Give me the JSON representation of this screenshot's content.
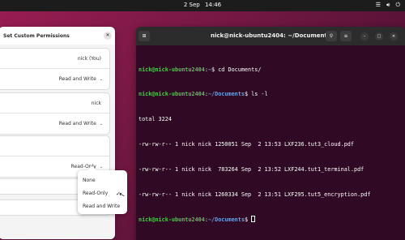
{
  "topbar": {
    "date": "2 Sep",
    "time": "14:46"
  },
  "dialog": {
    "title": "Set Custom Permissions",
    "owner": {
      "name": "nick (You)",
      "access": "Read and Write"
    },
    "group": {
      "name": "nick",
      "access": "Read and Write"
    },
    "others": {
      "access": "Read-Only"
    }
  },
  "dropdown": {
    "options": [
      "None",
      "Read-Only",
      "Read and Write"
    ],
    "selected": "Read-Only"
  },
  "terminal": {
    "title": "nick@nick-ubuntu2404: ~/Documents",
    "lines": [
      {
        "user": "nick@nick-ubuntu2404",
        "path": "~",
        "cmd": "cd Documents/"
      },
      {
        "user": "nick@nick-ubuntu2404",
        "path": "~/Documents",
        "cmd": "ls -l"
      },
      {
        "text": "total 3224"
      },
      {
        "text": "-rw-rw-r-- 1 nick nick 1250051 Sep  2 13:53 LXF236.tut3_cloud.pdf"
      },
      {
        "text": "-rw-rw-r-- 1 nick nick  783264 Sep  2 13:52 LXF244.tut1_terminal.pdf"
      },
      {
        "text": "-rw-rw-r-- 1 nick nick 1260334 Sep  2 13:51 LXF295.tut5_encryption.pdf"
      },
      {
        "user": "nick@nick-ubuntu2404",
        "path": "~/Documents",
        "cmd": ""
      }
    ]
  }
}
